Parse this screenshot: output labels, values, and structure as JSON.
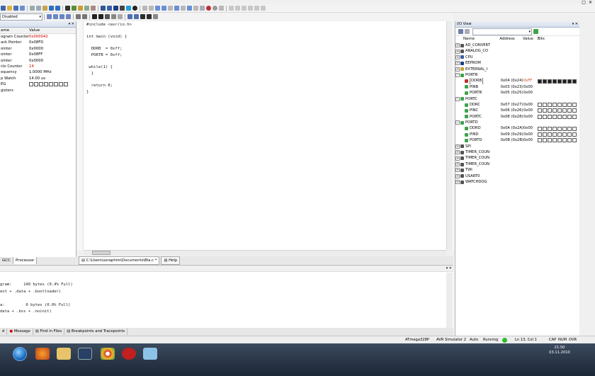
{
  "toolbar": {
    "config_combo": "Disabled"
  },
  "window": {
    "close_glyph": "✕",
    "restore_glyph": "□",
    "minimize_glyph": "_"
  },
  "processor": {
    "title": "",
    "columns": [
      "ame",
      "Value"
    ],
    "rows": [
      {
        "name": "ogram Counter",
        "value": "0x000042",
        "color": "#d00000"
      },
      {
        "name": "ack Pointer",
        "value": "0x08FD"
      },
      {
        "name": "ointer",
        "value": "0x0000"
      },
      {
        "name": "ointer",
        "value": "0x08FF"
      },
      {
        "name": "ointer",
        "value": "0x0000"
      },
      {
        "name": "cle Counter",
        "value": "14",
        "color": "#d00000"
      },
      {
        "name": "equency",
        "value": "1.0000 MHz"
      },
      {
        "name": "p Watch",
        "value": "14.00 us"
      },
      {
        "name": "EG",
        "value": ""
      },
      {
        "name": "gisters",
        "value": ""
      }
    ],
    "tabs": [
      "GCC",
      "Processor"
    ]
  },
  "editor": {
    "code_lines": [
      "#include <avr/io.h>",
      "",
      "int main (void) {",
      "",
      "  DDRB  = 0xff;",
      "  PORTB = 0xff;",
      "",
      " while(1) {",
      "  }",
      "",
      "  return 0;",
      "}"
    ],
    "tabs": [
      "C:\\Users\\seraphim\\Documents\\Bla.c *",
      "Help"
    ]
  },
  "io_view": {
    "title": "I/O View",
    "columns": [
      "Name",
      "Address",
      "Value",
      "Bits"
    ],
    "items": [
      {
        "kind": "group",
        "name": "AD_CONVERT",
        "icon": "adc-icon"
      },
      {
        "kind": "group",
        "name": "ANALOG_CO",
        "icon": "analog-icon"
      },
      {
        "kind": "group",
        "name": "CPU",
        "icon": "cpu-icon"
      },
      {
        "kind": "group",
        "name": "EEPROM",
        "icon": "eeprom-icon"
      },
      {
        "kind": "group",
        "name": "EXTERNAL_I",
        "icon": "interrupt-icon"
      },
      {
        "kind": "group",
        "name": "PORTB",
        "icon": "port-icon"
      },
      {
        "kind": "reg",
        "name": "DDRB",
        "addr": "0x04 (0x24)",
        "value": "0xFF",
        "bits": [
          1,
          1,
          1,
          1,
          1,
          1,
          1,
          1
        ],
        "highlight": true
      },
      {
        "kind": "reg",
        "name": "PINB",
        "addr": "0x03 (0x23)",
        "value": "0x00",
        "bits": []
      },
      {
        "kind": "reg",
        "name": "PORTB",
        "addr": "0x05 (0x25)",
        "value": "0x00",
        "bits": []
      },
      {
        "kind": "group",
        "name": "PORTC",
        "icon": "port-icon"
      },
      {
        "kind": "reg",
        "name": "DDRC",
        "addr": "0x07 (0x27)",
        "value": "0x00",
        "bits": [
          0,
          0,
          0,
          0,
          0,
          0,
          0,
          0
        ]
      },
      {
        "kind": "reg",
        "name": "PINC",
        "addr": "0x06 (0x26)",
        "value": "0x00",
        "bits": [
          0,
          0,
          0,
          0,
          0,
          0,
          0,
          0
        ]
      },
      {
        "kind": "reg",
        "name": "PORTC",
        "addr": "0x08 (0x28)",
        "value": "0x00",
        "bits": [
          0,
          0,
          0,
          0,
          0,
          0,
          0,
          0
        ]
      },
      {
        "kind": "group",
        "name": "PORTD",
        "icon": "port-icon"
      },
      {
        "kind": "reg",
        "name": "DDRD",
        "addr": "0x0A (0x2A)",
        "value": "0x00",
        "bits": [
          0,
          0,
          0,
          0,
          0,
          0,
          0,
          0
        ]
      },
      {
        "kind": "reg",
        "name": "PIND",
        "addr": "0x09 (0x29)",
        "value": "0x00",
        "bits": [
          0,
          0,
          0,
          0,
          0,
          0,
          0,
          0
        ]
      },
      {
        "kind": "reg",
        "name": "PORTD",
        "addr": "0x0B (0x2B)",
        "value": "0x00",
        "bits": [
          0,
          0,
          0,
          0,
          0,
          0,
          0,
          0
        ]
      },
      {
        "kind": "group",
        "name": "SPI",
        "icon": "spi-icon"
      },
      {
        "kind": "group",
        "name": "TIMER_COUN",
        "icon": "timer-icon"
      },
      {
        "kind": "group",
        "name": "TIMER_COUN",
        "icon": "timer-icon"
      },
      {
        "kind": "group",
        "name": "TIMER_COUN",
        "icon": "timer-icon"
      },
      {
        "kind": "group",
        "name": "TWI",
        "icon": "twi-icon"
      },
      {
        "kind": "group",
        "name": "USART0",
        "icon": "usart-icon"
      },
      {
        "kind": "group",
        "name": "WATCHDOG",
        "icon": "watchdog-icon"
      }
    ]
  },
  "output": {
    "lines": [
      "gram:     140 bytes (0.4% Full)",
      "ext + .data + .bootloader)",
      "",
      "a:         0 bytes (0.0% Full)",
      "data + .bss + .noinit)"
    ],
    "tabs": [
      "d",
      "Message",
      "Find in Files",
      "Breakpoints and Tracepoints"
    ]
  },
  "status": {
    "device": "ATmega328P",
    "simulator": "AVR Simulator 2",
    "mode": "Auto",
    "state": "Running",
    "cursor": "Ln 13, Col 1",
    "caps": "CAP",
    "num": "NUM",
    "ovr": "OVR"
  },
  "taskbar": {
    "time": "21:50",
    "date": "03.11.2010"
  },
  "colors": {
    "accent_red": "#d00000",
    "running_green": "#2bbd2b",
    "io_highlight_value": "#d04020"
  }
}
